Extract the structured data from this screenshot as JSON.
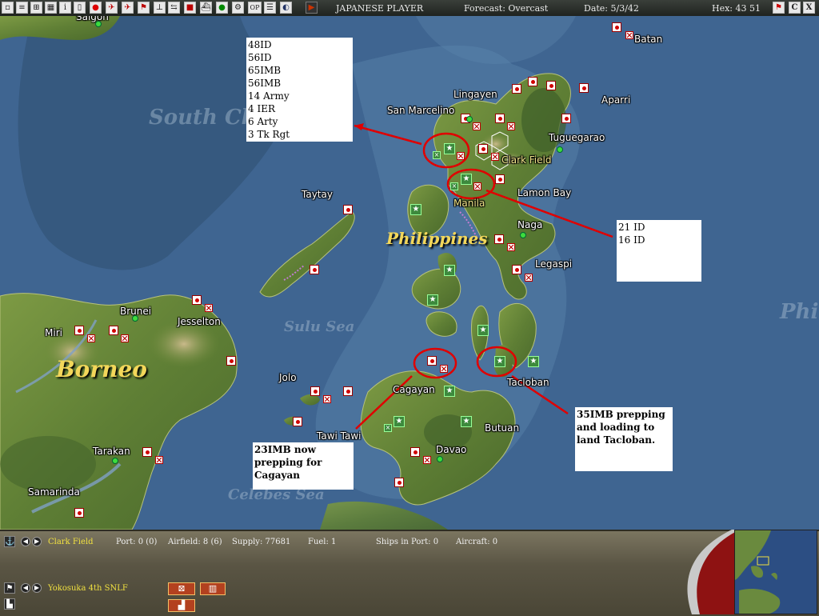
{
  "topbar": {
    "side": "JAPANESE PLAYER",
    "forecast": "Forecast: Overcast",
    "date": "Date: 5/3/42",
    "hex": "Hex: 43 51",
    "buttons": [
      "window-icon",
      "document-icon",
      "reports-icon",
      "grid-icon",
      "info-icon",
      "flag-icon",
      "plane-icon",
      "aircraft-icon",
      "flag-outline-icon",
      "landing-icon",
      "transfer-icon",
      "unit-icon",
      "ship-icon",
      "globe-icon",
      "settings-icon",
      "op-icon",
      "list-icon",
      "map-icon",
      "play-icon"
    ],
    "op_label": "OP",
    "right_buttons": [
      "flag-icon",
      "C",
      "X"
    ]
  },
  "map": {
    "places": [
      {
        "name": "Saigon",
        "color": "white"
      },
      {
        "name": "Batan",
        "color": "white"
      },
      {
        "name": "Lingayen",
        "color": "white"
      },
      {
        "name": "Aparri",
        "color": "white"
      },
      {
        "name": "San Marcelino",
        "color": "white"
      },
      {
        "name": "Tuguegarao",
        "color": "white"
      },
      {
        "name": "Clark Field",
        "color": "yellow"
      },
      {
        "name": "Lamon Bay",
        "color": "white"
      },
      {
        "name": "Taytay",
        "color": "white"
      },
      {
        "name": "Manila",
        "color": "yellow"
      },
      {
        "name": "Naga",
        "color": "white"
      },
      {
        "name": "Legaspi",
        "color": "white"
      },
      {
        "name": "Brunei",
        "color": "white"
      },
      {
        "name": "Jesselton",
        "color": "white"
      },
      {
        "name": "Miri",
        "color": "white"
      },
      {
        "name": "Jolo",
        "color": "white"
      },
      {
        "name": "Cagayan",
        "color": "white"
      },
      {
        "name": "Tacloban",
        "color": "white"
      },
      {
        "name": "Butuan",
        "color": "white"
      },
      {
        "name": "Tawi Tawi",
        "color": "white"
      },
      {
        "name": "Davao",
        "color": "white"
      },
      {
        "name": "Tarakan",
        "color": "white"
      },
      {
        "name": "Samarinda",
        "color": "white"
      }
    ],
    "regions": {
      "borneo": "Borneo",
      "philippines": "Philippines",
      "south_china": "South Ch",
      "sulu": "Sulu Sea",
      "celebes": "Celebes Sea",
      "phi_edge": "Phi"
    }
  },
  "notes": {
    "north": [
      "48ID",
      "56ID",
      "65IMB",
      "56IMB",
      "14 Army",
      "4 IER",
      "6 Arty",
      "3 Tk Rgt"
    ],
    "east": [
      "21 ID",
      "16 ID"
    ],
    "south_west": [
      "23IMB now",
      "prepping for",
      "Cagayan"
    ],
    "south_east": [
      "35IMB prepping",
      "and loading to",
      "land Tacloban."
    ]
  },
  "bottom": {
    "base": "Clark Field",
    "port": "Port: 0 (0)",
    "airfield": "Airfield: 8 (6)",
    "supply": "Supply: 77681",
    "fuel": "Fuel: 1",
    "ships": "Ships in Port: 0",
    "aircraft": "Aircraft: 0",
    "unit": "Yokosuka 4th SNLF"
  },
  "colors": {
    "accent": "#d00000",
    "map_sea": "#3f6591",
    "land": "#6f8a3a",
    "panel": "#5a5544"
  }
}
